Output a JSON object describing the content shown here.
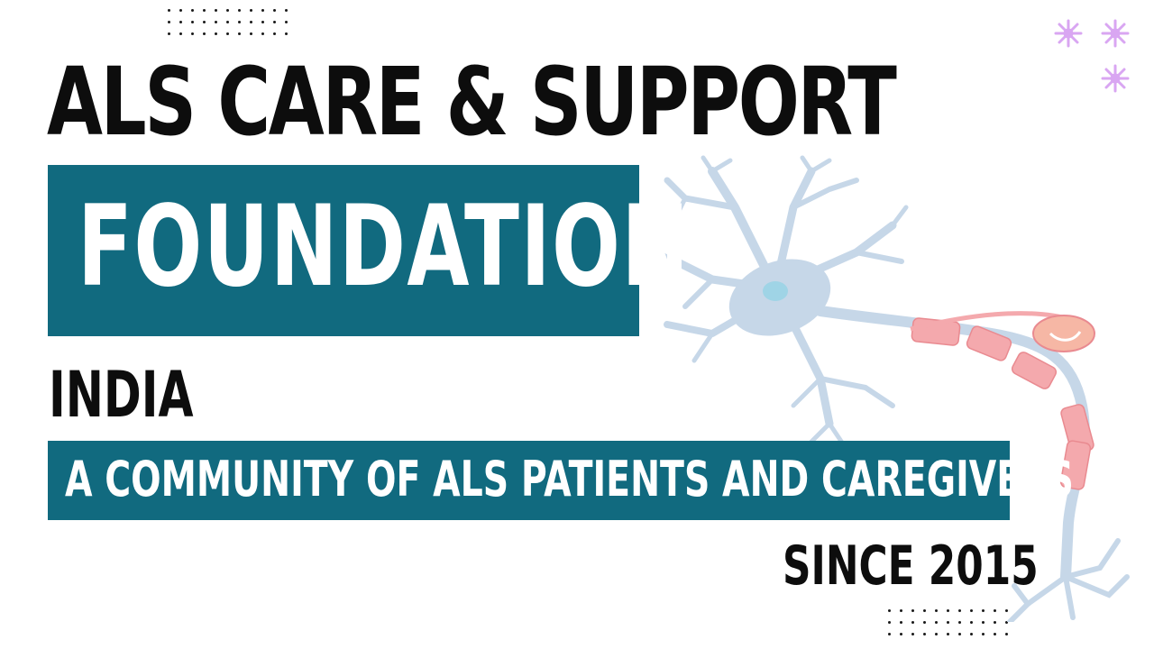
{
  "header": {
    "title": "ALS CARE & SUPPORT"
  },
  "banner": {
    "label": "FOUNDATION",
    "background_color": "#116a7f",
    "text_color": "#ffffff"
  },
  "location": {
    "country": "INDIA"
  },
  "tagline": {
    "text": "A COMMUNITY OF ALS PATIENTS AND CAREGIVERS",
    "background_color": "#116a7f"
  },
  "footer": {
    "since": "SINCE 2015"
  },
  "decorations": {
    "illustration_icon": "neuron-icon",
    "flower_icon": "flower-icon",
    "neuron_body_color": "#c6d7e8",
    "myelin_color": "#f4a9ad",
    "flower_color": "#d9a6f2"
  }
}
